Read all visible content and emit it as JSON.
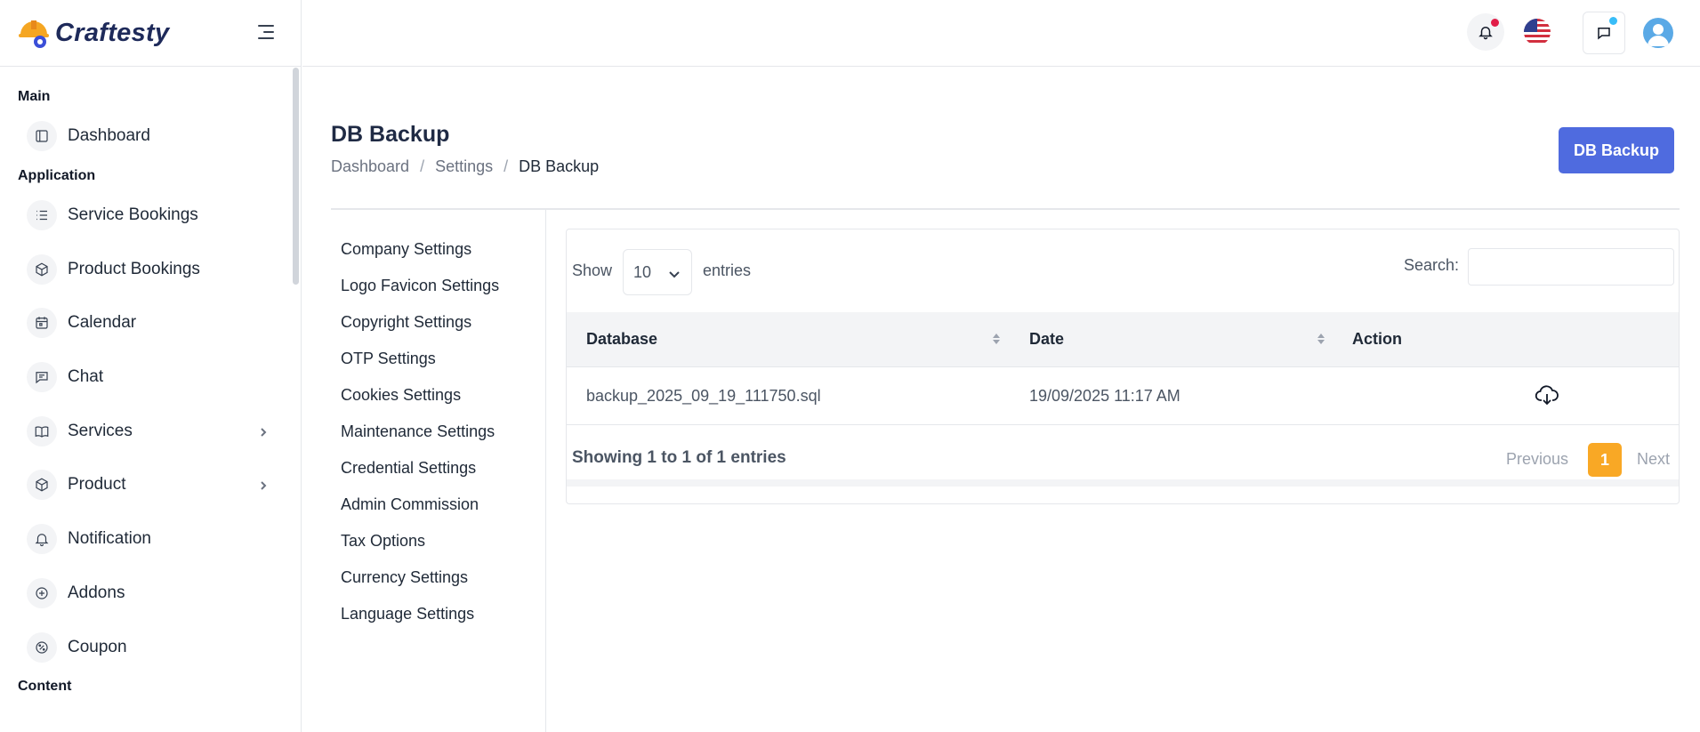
{
  "brand": {
    "name": "Craftesty"
  },
  "sidebar": {
    "sections": [
      {
        "title": "Main",
        "items": [
          {
            "label": "Dashboard",
            "icon": "layout-sidebar-icon",
            "submenu": false
          }
        ]
      },
      {
        "title": "Application",
        "items": [
          {
            "label": "Service Bookings",
            "icon": "list-icon",
            "submenu": false
          },
          {
            "label": "Product Bookings",
            "icon": "box-icon",
            "submenu": false
          },
          {
            "label": "Calendar",
            "icon": "calendar-icon",
            "submenu": false
          },
          {
            "label": "Chat",
            "icon": "chat-icon",
            "submenu": false
          },
          {
            "label": "Services",
            "icon": "book-icon",
            "submenu": true
          },
          {
            "label": "Product",
            "icon": "box-icon",
            "submenu": true
          },
          {
            "label": "Notification",
            "icon": "bell-icon",
            "submenu": false
          },
          {
            "label": "Addons",
            "icon": "plus-circle-icon",
            "submenu": false
          },
          {
            "label": "Coupon",
            "icon": "percent-icon",
            "submenu": false
          }
        ]
      },
      {
        "title": "Content",
        "items": []
      }
    ]
  },
  "header": {
    "notification_dot_color": "#e11d48",
    "chat_dot_color": "#38bdf8",
    "language": "en-US"
  },
  "page": {
    "title": "DB Backup",
    "breadcrumb": [
      "Dashboard",
      "Settings",
      "DB Backup"
    ],
    "action_button": "DB Backup",
    "accent_color": "#4f6bdf"
  },
  "settings_menu": [
    "Company Settings",
    "Logo Favicon Settings",
    "Copyright Settings",
    "OTP Settings",
    "Cookies Settings",
    "Maintenance Settings",
    "Credential Settings",
    "Admin Commission",
    "Tax Options",
    "Currency Settings",
    "Language Settings"
  ],
  "table": {
    "show_label": "Show",
    "page_length": "10",
    "entries_label": "entries",
    "search_label": "Search:",
    "search_value": "",
    "columns": [
      "Database",
      "Date",
      "Action"
    ],
    "rows": [
      {
        "database": "backup_2025_09_19_111750.sql",
        "date": "19/09/2025 11:17 AM",
        "action_icon": "cloud-download-icon"
      }
    ],
    "info": "Showing 1 to 1 of 1 entries",
    "pagination": {
      "previous": "Previous",
      "current_page": "1",
      "next": "Next"
    },
    "page_color": "#f9a825"
  }
}
